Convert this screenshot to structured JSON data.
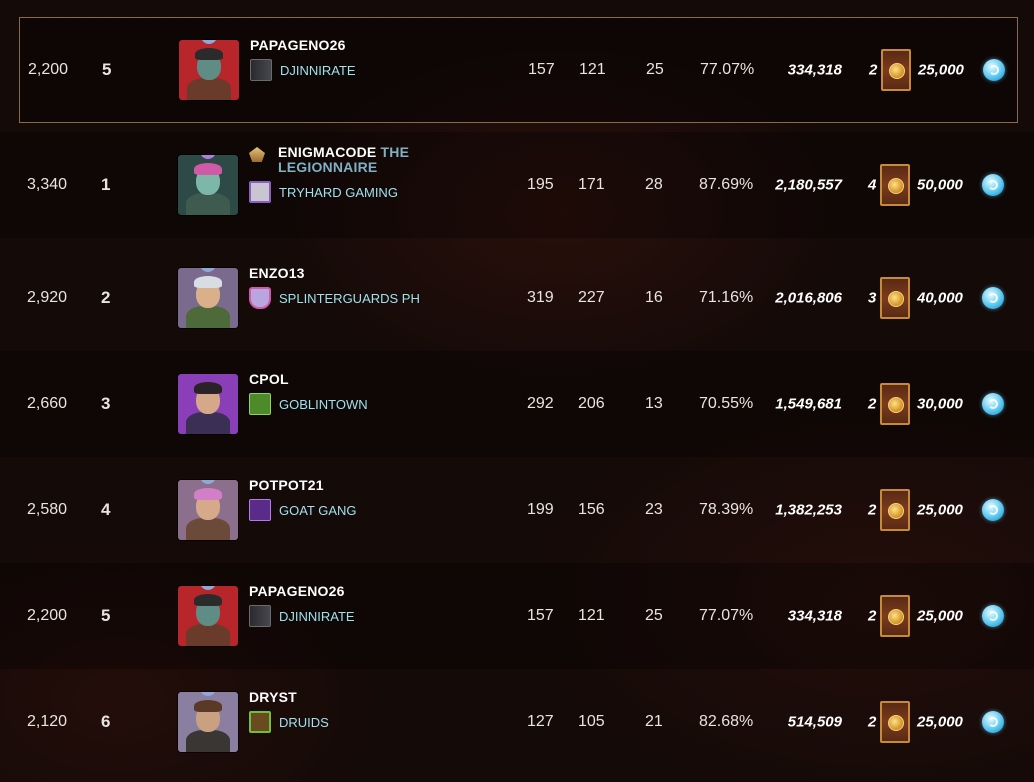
{
  "rows": [
    {
      "rating": "2,200",
      "rank": "5",
      "name": "PAPAGENO26",
      "title": "",
      "guild": "DJINNIRATE",
      "n1": "157",
      "n2": "121",
      "n3": "25",
      "pct": "77.07%",
      "power": "334,318",
      "chests": "2",
      "reward": "25,000",
      "avatar": "green-orc",
      "guild_icon": "dark-banner"
    },
    {
      "rating": "3,340",
      "rank": "1",
      "name": "ENIGMACODE",
      "title": "THE LEGIONNAIRE",
      "guild": "TRYHARD GAMING",
      "n1": "195",
      "n2": "171",
      "n3": "28",
      "pct": "87.69%",
      "power": "2,180,557",
      "chests": "4",
      "reward": "50,000",
      "avatar": "teal-elf",
      "guild_icon": "hooded-figure"
    },
    {
      "rating": "2,920",
      "rank": "2",
      "name": "ENZO13",
      "title": "",
      "guild": "SPLINTERGUARDS PH",
      "n1": "319",
      "n2": "227",
      "n3": "16",
      "pct": "71.16%",
      "power": "2,016,806",
      "chests": "3",
      "reward": "40,000",
      "avatar": "silver-hair",
      "guild_icon": "shield"
    },
    {
      "rating": "2,660",
      "rank": "3",
      "name": "CPOL",
      "title": "",
      "guild": "GOBLINTOWN",
      "n1": "292",
      "n2": "206",
      "n3": "13",
      "pct": "70.55%",
      "power": "1,549,681",
      "chests": "2",
      "reward": "30,000",
      "avatar": "purple-bg-man",
      "guild_icon": "goblin"
    },
    {
      "rating": "2,580",
      "rank": "4",
      "name": "POTPOT21",
      "title": "",
      "guild": "GOAT GANG",
      "n1": "199",
      "n2": "156",
      "n3": "23",
      "pct": "78.39%",
      "power": "1,382,253",
      "chests": "2",
      "reward": "25,000",
      "avatar": "pink-hair",
      "guild_icon": "purple-hand"
    },
    {
      "rating": "2,200",
      "rank": "5",
      "name": "PAPAGENO26",
      "title": "",
      "guild": "DJINNIRATE",
      "n1": "157",
      "n2": "121",
      "n3": "25",
      "pct": "77.07%",
      "power": "334,318",
      "chests": "2",
      "reward": "25,000",
      "avatar": "green-orc",
      "guild_icon": "dark-banner"
    },
    {
      "rating": "2,120",
      "rank": "6",
      "name": "DRYST",
      "title": "",
      "guild": "DRUIDS",
      "n1": "127",
      "n2": "105",
      "n3": "21",
      "pct": "82.68%",
      "power": "514,509",
      "chests": "2",
      "reward": "25,000",
      "avatar": "brown-hair-man",
      "guild_icon": "green-book"
    }
  ],
  "colors": {
    "highlight_border": "#8a6a45",
    "guild_text": "#9fe1ee",
    "title_text": "#7fb0c4"
  }
}
